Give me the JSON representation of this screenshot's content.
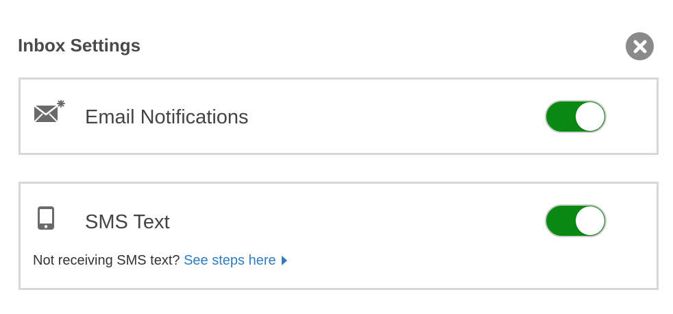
{
  "header": {
    "title": "Inbox Settings",
    "close_icon": "close-icon"
  },
  "settings": [
    {
      "id": "email",
      "icon": "envelope-icon",
      "label": "Email Notifications",
      "enabled": true
    },
    {
      "id": "sms",
      "icon": "mobile-phone-icon",
      "label": "SMS Text",
      "enabled": true,
      "help_text": "Not receiving SMS text?",
      "help_link": "See steps here"
    }
  ],
  "colors": {
    "toggle_on": "#0a8a12",
    "link": "#2e7bbf",
    "border": "#d7d7d7",
    "close_button": "#8a8a8a"
  }
}
